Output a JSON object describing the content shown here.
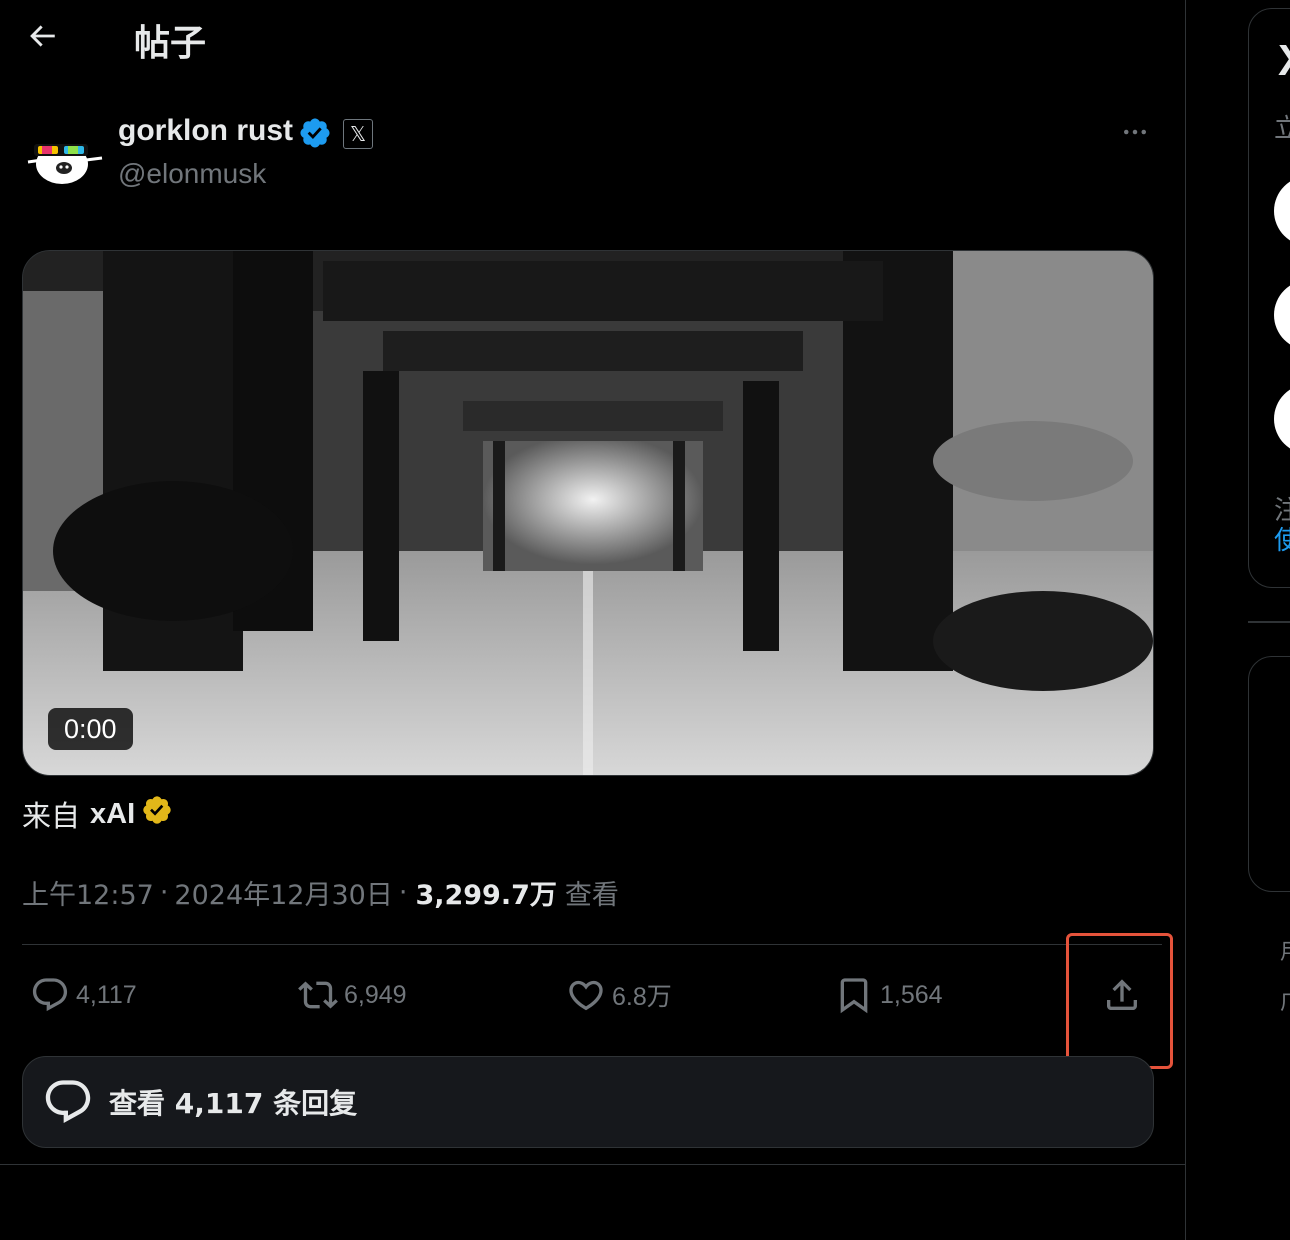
{
  "header": {
    "title": "帖子"
  },
  "post": {
    "author_name": "gorklon rust",
    "author_handle": "@elonmusk",
    "affiliate_label": "𝕏",
    "video_time": "0:00",
    "source_prefix": "来自",
    "source_name": "xAI",
    "time": "上午12:57",
    "separator": "·",
    "date": "2024年12月30日",
    "views_count": "3,299.7万",
    "views_label": "查看"
  },
  "actions": {
    "replies": "4,117",
    "reposts": "6,949",
    "likes": "6.8万",
    "bookmarks": "1,564"
  },
  "replies_button": {
    "label": "查看 4,117 条回复"
  },
  "sidebar": {
    "logo": "X",
    "glyph_1": "立",
    "glyph_2": "注",
    "glyph_3": "使",
    "glyph_4": "用",
    "glyph_5": "广"
  },
  "colors": {
    "background": "#000000",
    "text_primary": "#e7e9ea",
    "text_secondary": "#71767b",
    "border": "#2f3336",
    "verified_blue": "#1d9bf0",
    "verified_gold": "#e2b719",
    "highlight": "#e5533b"
  },
  "icons": {
    "back": "arrow-left-icon",
    "verified": "verified-badge-icon",
    "more": "more-horizontal-icon",
    "reply": "reply-icon",
    "repost": "repost-icon",
    "like": "heart-icon",
    "bookmark": "bookmark-icon",
    "share": "share-icon",
    "replies_bubble": "chat-bubble-icon"
  }
}
